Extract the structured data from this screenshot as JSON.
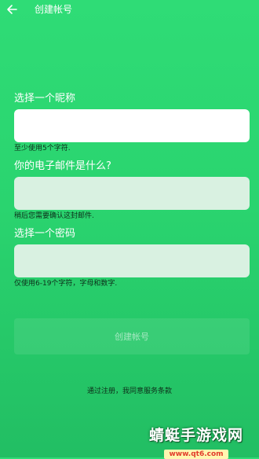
{
  "header": {
    "title": "创建帐号",
    "back_icon": "arrow-left-icon"
  },
  "form": {
    "nickname": {
      "label": "选择一个昵称",
      "value": "",
      "hint": "至少使用5个字符."
    },
    "email": {
      "label": "你的电子邮件是什么?",
      "value": "",
      "hint": "稍后您需要确认这封邮件."
    },
    "password": {
      "label": "选择一个密码",
      "value": "",
      "hint": "仅使用6-19个字符，字母和数字."
    }
  },
  "create_button": {
    "label": "创建帐号"
  },
  "terms_text": "通过注册，我同意服务条款",
  "watermark": {
    "name": "蜻蜓手游戏网",
    "url": "www.qt6.com"
  },
  "colors": {
    "background": "#2ad46f",
    "hint_text": "#0d2e1a"
  }
}
